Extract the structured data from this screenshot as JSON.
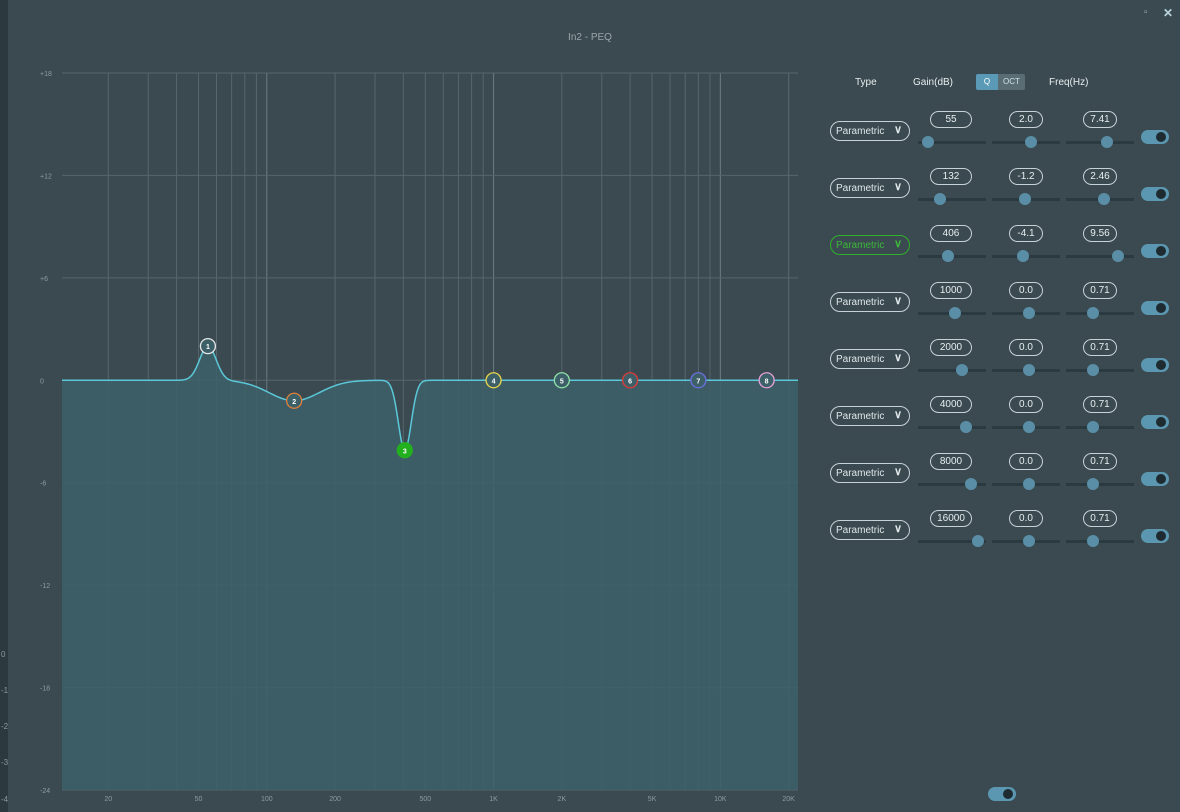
{
  "window": {
    "title": "In2 - PEQ",
    "maximize_glyph": "▫",
    "close_glyph": "✕"
  },
  "left_strip_values": [
    "0",
    "-1",
    "-2",
    "-3",
    "-4"
  ],
  "graph": {
    "y_ticks": [
      "+18",
      "+12",
      "+6",
      "0",
      "-6",
      "-12",
      "-18",
      "-24"
    ],
    "x_ticks": [
      "20",
      "50",
      "100",
      "200",
      "500",
      "1K",
      "2K",
      "5K",
      "10K",
      "20K"
    ],
    "colors": {
      "background": "#3a4a50",
      "fill": "#3d6068",
      "curve": "#5ac8d8",
      "grid": "#56666c"
    }
  },
  "header": {
    "type_label": "Type",
    "gain_label": "Gain(dB)",
    "q_label": "Q",
    "oct_label": "OCT",
    "freq_label": "Freq(Hz)"
  },
  "bands": [
    {
      "id": "1",
      "type": "Parametric",
      "freq": "55",
      "gain": "2.0",
      "q": "7.41",
      "freq_hz": 55,
      "gain_db": 2.0,
      "q_val": 7.41,
      "color": "#e8e8e8",
      "filled": false,
      "active": false,
      "enabled": true,
      "slider_freq": 0.15,
      "slider_gain": 0.58,
      "slider_q": 0.6
    },
    {
      "id": "2",
      "type": "Parametric",
      "freq": "132",
      "gain": "-1.2",
      "q": "2.46",
      "freq_hz": 132,
      "gain_db": -1.2,
      "q_val": 2.46,
      "color": "#e0803a",
      "filled": false,
      "active": false,
      "enabled": true,
      "slider_freq": 0.32,
      "slider_gain": 0.48,
      "slider_q": 0.56
    },
    {
      "id": "3",
      "type": "Parametric",
      "freq": "406",
      "gain": "-4.1",
      "q": "9.56",
      "freq_hz": 406,
      "gain_db": -4.1,
      "q_val": 9.56,
      "color": "#22b01e",
      "filled": true,
      "active": true,
      "enabled": true,
      "slider_freq": 0.44,
      "slider_gain": 0.45,
      "slider_q": 0.76
    },
    {
      "id": "4",
      "type": "Parametric",
      "freq": "1000",
      "gain": "0.0",
      "q": "0.71",
      "freq_hz": 1000,
      "gain_db": 0.0,
      "q_val": 0.71,
      "color": "#e8d44a",
      "filled": false,
      "active": false,
      "enabled": true,
      "slider_freq": 0.55,
      "slider_gain": 0.55,
      "slider_q": 0.4
    },
    {
      "id": "5",
      "type": "Parametric",
      "freq": "2000",
      "gain": "0.0",
      "q": "0.71",
      "freq_hz": 2000,
      "gain_db": 0.0,
      "q_val": 0.71,
      "color": "#8ee0a8",
      "filled": false,
      "active": false,
      "enabled": true,
      "slider_freq": 0.64,
      "slider_gain": 0.55,
      "slider_q": 0.4
    },
    {
      "id": "6",
      "type": "Parametric",
      "freq": "4000",
      "gain": "0.0",
      "q": "0.71",
      "freq_hz": 4000,
      "gain_db": 0.0,
      "q_val": 0.71,
      "color": "#e03a3a",
      "filled": false,
      "active": false,
      "enabled": true,
      "slider_freq": 0.7,
      "slider_gain": 0.55,
      "slider_q": 0.4
    },
    {
      "id": "7",
      "type": "Parametric",
      "freq": "8000",
      "gain": "0.0",
      "q": "0.71",
      "freq_hz": 8000,
      "gain_db": 0.0,
      "q_val": 0.71,
      "color": "#6a6ee0",
      "filled": false,
      "active": false,
      "enabled": true,
      "slider_freq": 0.78,
      "slider_gain": 0.55,
      "slider_q": 0.4
    },
    {
      "id": "8",
      "type": "Parametric",
      "freq": "16000",
      "gain": "0.0",
      "q": "0.71",
      "freq_hz": 16000,
      "gain_db": 0.0,
      "q_val": 0.71,
      "color": "#e6a0d8",
      "filled": false,
      "active": false,
      "enabled": true,
      "slider_freq": 0.88,
      "slider_gain": 0.55,
      "slider_q": 0.4
    }
  ],
  "master_enabled": true
}
